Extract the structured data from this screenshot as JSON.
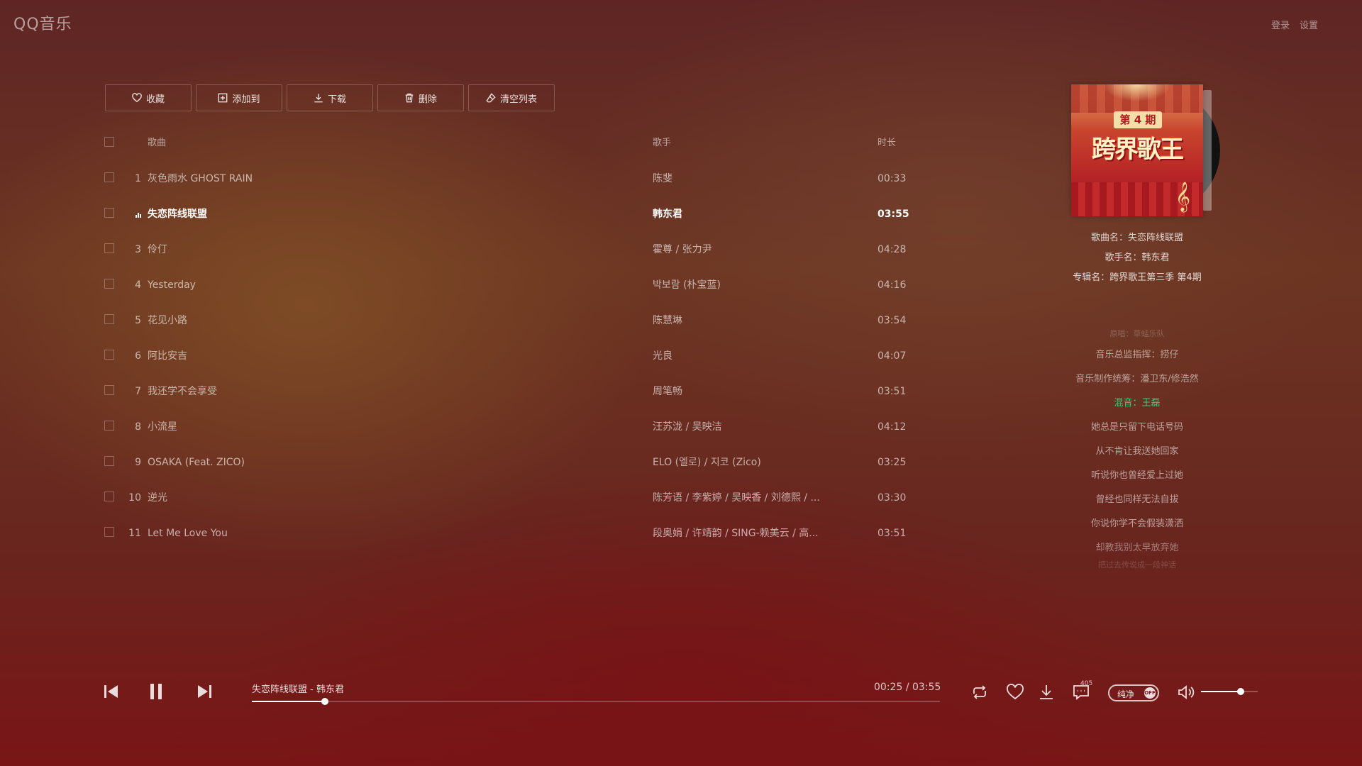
{
  "app": {
    "logo": "QQ音乐"
  },
  "top_links": {
    "login": "登录",
    "settings": "设置"
  },
  "toolbar": {
    "favorite": "收藏",
    "add_to": "添加到",
    "download": "下载",
    "delete": "删除",
    "clear_list": "清空列表"
  },
  "list_header": {
    "song": "歌曲",
    "artist": "歌手",
    "duration": "时长"
  },
  "songs": [
    {
      "num": "1",
      "title": "灰色雨水 GHOST RAIN",
      "artist": "陈斐",
      "duration": "00:33"
    },
    {
      "num": "",
      "title": "失恋阵线联盟",
      "artist": "韩东君",
      "duration": "03:55",
      "playing": true
    },
    {
      "num": "3",
      "title": "伶仃",
      "artist": "霍尊 / 张力尹",
      "duration": "04:28"
    },
    {
      "num": "4",
      "title": "Yesterday",
      "artist": "박보람 (朴宝蓝)",
      "duration": "04:16"
    },
    {
      "num": "5",
      "title": "花见小路",
      "artist": "陈慧琳",
      "duration": "03:54"
    },
    {
      "num": "6",
      "title": "阿比安吉",
      "artist": "光良",
      "duration": "04:07"
    },
    {
      "num": "7",
      "title": "我还学不会享受",
      "artist": "周笔畅",
      "duration": "03:51"
    },
    {
      "num": "8",
      "title": "小流星",
      "artist": "汪苏泷 / 吴映洁",
      "duration": "04:12"
    },
    {
      "num": "9",
      "title": "OSAKA (Feat. ZICO)",
      "artist": "ELO (엘로) / 지코 (Zico)",
      "duration": "03:25"
    },
    {
      "num": "10",
      "title": "逆光",
      "artist": "陈芳语 / 李紫婷 / 吴映香 / 刘德熙 / ...",
      "duration": "03:30"
    },
    {
      "num": "11",
      "title": "Let Me Love You",
      "artist": "段奥娟 / 许靖韵 / SING-赖美云 / 高...",
      "duration": "03:51"
    }
  ],
  "cover": {
    "issue": "第 4 期",
    "show": "跨界歌王"
  },
  "now_playing": {
    "song_name": "歌曲名：失恋阵线联盟",
    "artist_name": "歌手名：韩东君",
    "album_name": "专辑名：跨界歌王第三季 第4期"
  },
  "lyrics": [
    "原唱：草蜢乐队",
    "音乐总监指挥：捞仔",
    "音乐制作统筹：潘卫东/修浩然",
    "混音：王磊",
    "她总是只留下电话号码",
    "从不肯让我送她回家",
    "听说你也曾经爱上过她",
    "曾经也同样无法自拔",
    "你说你学不会假装潇洒",
    "却教我别太早放弃她",
    "把过去传说成一段神话"
  ],
  "player": {
    "song_line": "失恋阵线联盟 - 韩东君",
    "current_time": "00:25",
    "separator": "/",
    "total_time": "03:55",
    "progress": 0.106,
    "volume": 0.7,
    "comment_count": "405",
    "pure_label": "纯净",
    "pure_state": "OFF"
  },
  "colors": {
    "lyric_active": "#2ed07b",
    "accent": "#ffffff"
  }
}
